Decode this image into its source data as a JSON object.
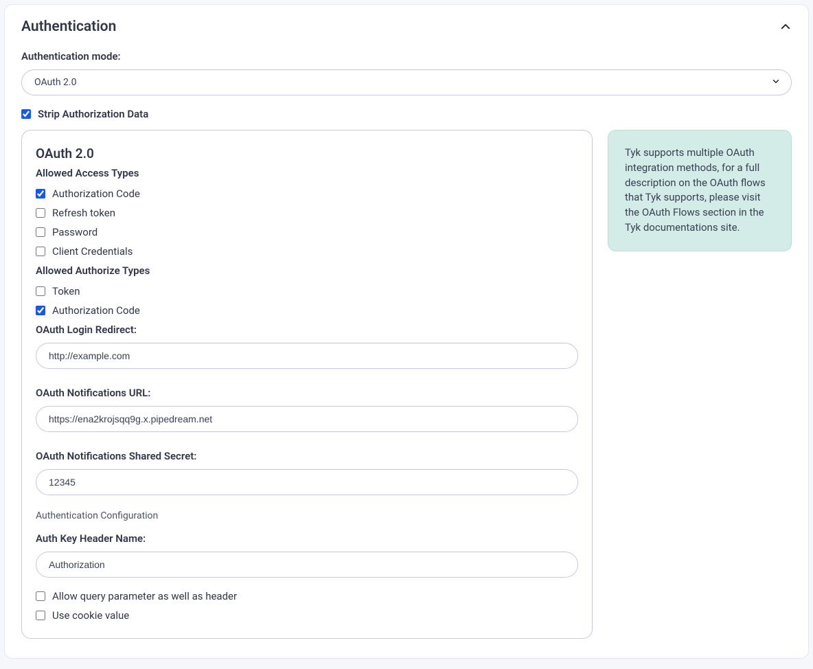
{
  "header": {
    "title": "Authentication"
  },
  "mode": {
    "label": "Authentication mode:",
    "value": "OAuth 2.0"
  },
  "strip": {
    "label": "Strip Authorization Data",
    "checked": true
  },
  "oauth": {
    "title": "OAuth 2.0",
    "allowed_access_label": "Allowed Access Types",
    "access": {
      "auth_code": {
        "label": "Authorization Code",
        "checked": true
      },
      "refresh": {
        "label": "Refresh token",
        "checked": false
      },
      "password": {
        "label": "Password",
        "checked": false
      },
      "client_cred": {
        "label": "Client Credentials",
        "checked": false
      }
    },
    "allowed_authorize_label": "Allowed Authorize Types",
    "authorize": {
      "token": {
        "label": "Token",
        "checked": false
      },
      "auth_code": {
        "label": "Authorization Code",
        "checked": true
      }
    },
    "login_redirect": {
      "label": "OAuth Login Redirect:",
      "value": "http://example.com"
    },
    "notifications_url": {
      "label": "OAuth Notifications URL:",
      "value": "https://ena2krojsqq9g.x.pipedream.net"
    },
    "notifications_secret": {
      "label": "OAuth Notifications Shared Secret:",
      "value": "12345"
    },
    "auth_config_heading": "Authentication Configuration",
    "auth_key_header": {
      "label": "Auth Key Header Name:",
      "value": "Authorization"
    },
    "allow_query": {
      "label": "Allow query parameter as well as header",
      "checked": false
    },
    "use_cookie": {
      "label": "Use cookie value",
      "checked": false
    }
  },
  "info": {
    "body": "Tyk supports multiple OAuth integration methods, for a full description on the OAuth flows that Tyk supports, please visit the OAuth Flows section in the Tyk documentations site."
  }
}
